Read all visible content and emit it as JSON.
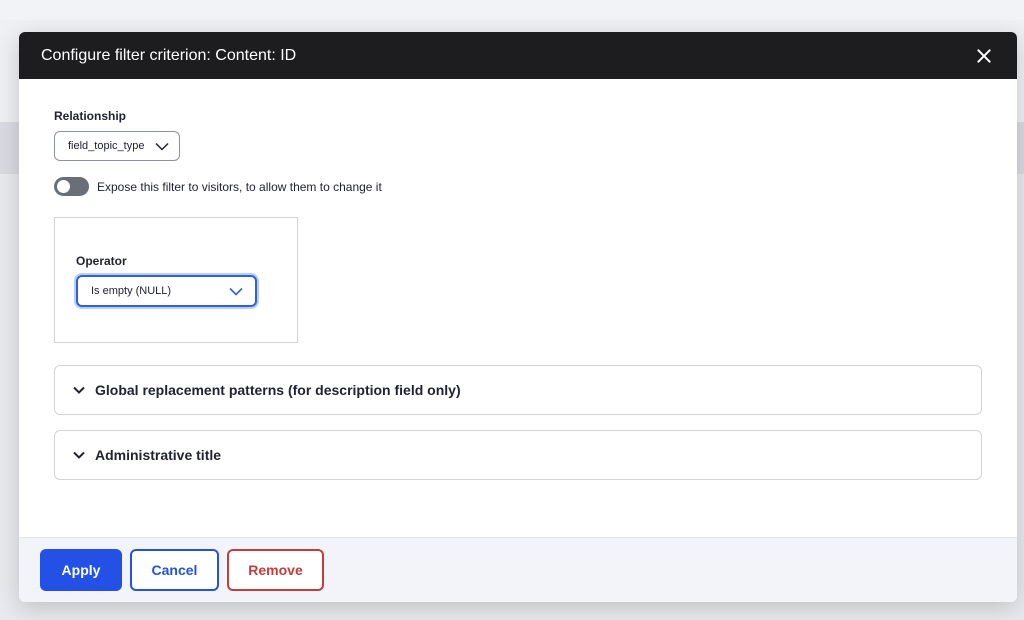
{
  "dialog": {
    "title": "Configure filter criterion: Content: ID",
    "close_icon": "close-icon"
  },
  "relationship": {
    "label": "Relationship",
    "selected": "field_topic_type"
  },
  "expose": {
    "label": "Expose this filter to visitors, to allow them to change it",
    "enabled": false
  },
  "operator": {
    "label": "Operator",
    "selected": "Is empty (NULL)"
  },
  "sections": [
    {
      "label": "Global replacement patterns (for description field only)",
      "icon": "chevron-down-icon"
    },
    {
      "label": "Administrative title",
      "icon": "chevron-down-icon"
    }
  ],
  "footer": {
    "apply_label": "Apply",
    "cancel_label": "Cancel",
    "remove_label": "Remove"
  },
  "colors": {
    "primary": "#2351e5",
    "danger": "#c63b3b",
    "titlebar": "#1d1d1f"
  }
}
